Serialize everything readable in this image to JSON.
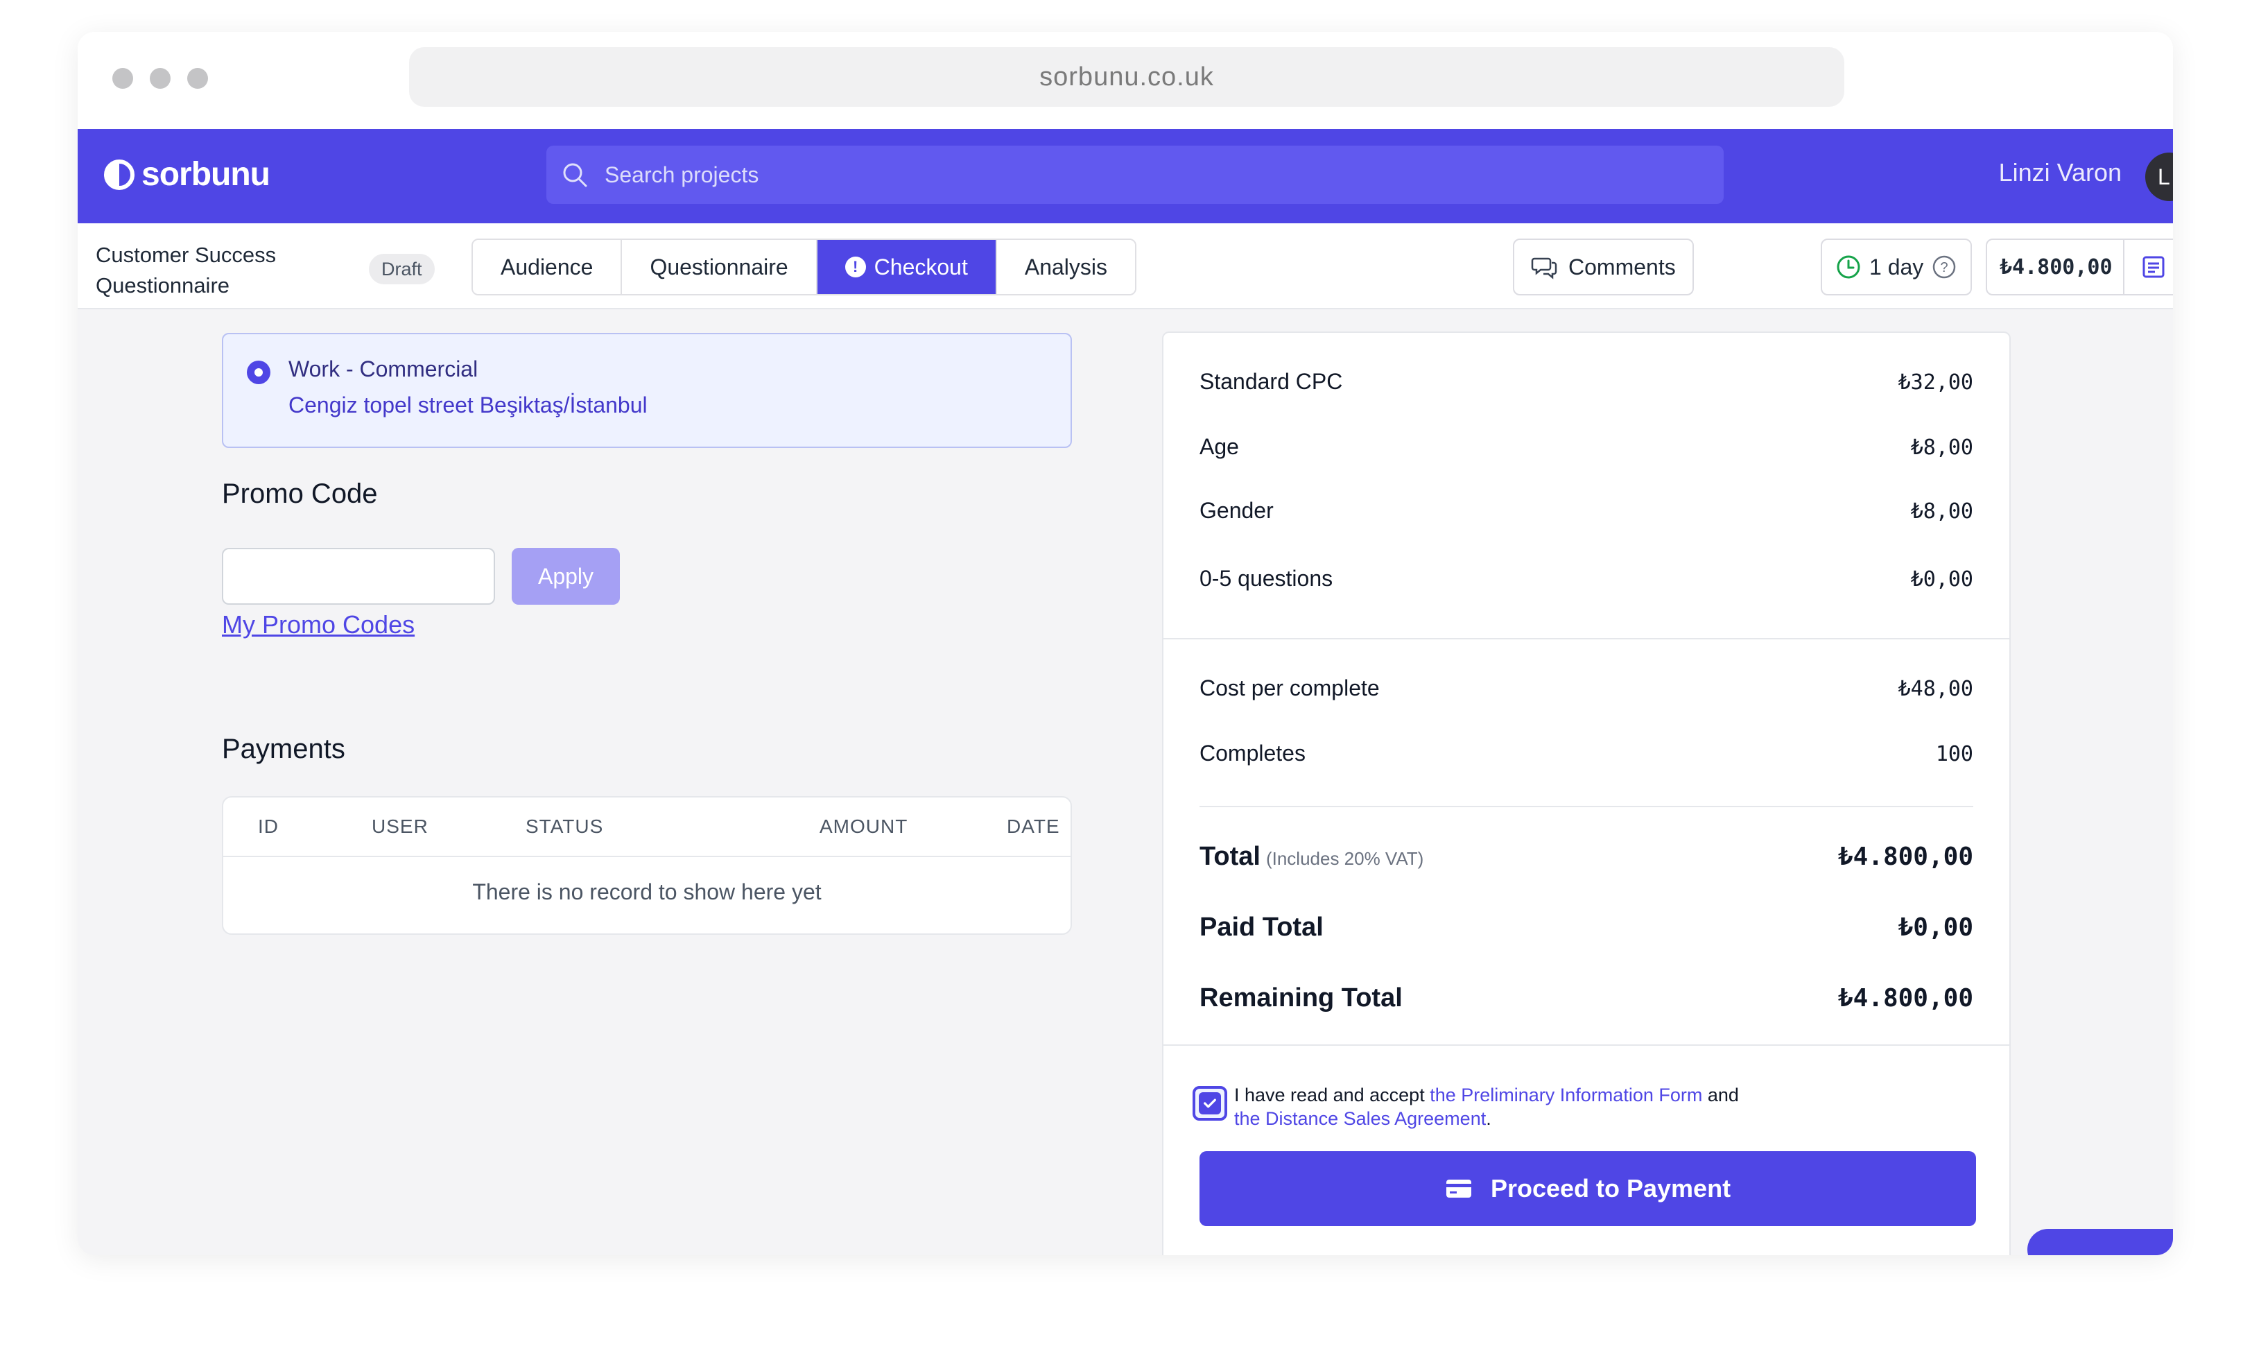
{
  "browser": {
    "url": "sorbunu.co.uk"
  },
  "header": {
    "logo_text": "sorbunu",
    "search_placeholder": "Search projects",
    "user_name": "Linzi Varon",
    "avatar_initial": "L"
  },
  "project": {
    "title": "Customer Success Questionnaire",
    "status_badge": "Draft",
    "tabs": [
      {
        "label": "Audience",
        "active": false
      },
      {
        "label": "Questionnaire",
        "active": false
      },
      {
        "label": "Checkout",
        "active": true,
        "icon": "alert-circle-icon"
      },
      {
        "label": "Analysis",
        "active": false
      }
    ],
    "comments_label": "Comments",
    "duration_label": "1 day",
    "budget_label": "₺4.800,00"
  },
  "address": {
    "title": "Work - Commercial",
    "line": "Cengiz topel street Beşiktaş/İstanbul",
    "selected": true
  },
  "promo": {
    "heading": "Promo Code",
    "input_value": "",
    "apply_label": "Apply",
    "my_codes_link": "My Promo Codes"
  },
  "payments": {
    "heading": "Payments",
    "columns": [
      "ID",
      "USER",
      "STATUS",
      "AMOUNT",
      "DATE"
    ],
    "empty_message": "There is no record to show here yet"
  },
  "summary": {
    "pricing": [
      {
        "label": "Standard CPC",
        "value": "₺32,00"
      },
      {
        "label": "Age",
        "value": "₺8,00"
      },
      {
        "label": "Gender",
        "value": "₺8,00"
      },
      {
        "label": "0-5 questions",
        "value": "₺0,00"
      }
    ],
    "cost_per_complete": {
      "label": "Cost per complete",
      "value": "₺48,00"
    },
    "completes": {
      "label": "Completes",
      "value": "100"
    },
    "total": {
      "label": "Total",
      "note": "(Includes 20% VAT)",
      "value": "₺4.800,00"
    },
    "paid_total": {
      "label": "Paid Total",
      "value": "₺0,00"
    },
    "remaining_total": {
      "label": "Remaining Total",
      "value": "₺4.800,00"
    },
    "agreement": {
      "checked": true,
      "prefix": "I have read and accept",
      "link1": "the Preliminary Information Form",
      "middle": "and",
      "link2": "the Distance Sales Agreement",
      "suffix": "."
    },
    "proceed_label": "Proceed to Payment"
  },
  "colors": {
    "brand": "#4f46e5",
    "content_bg": "#f4f4f6",
    "address_bg": "#eef2ff"
  }
}
